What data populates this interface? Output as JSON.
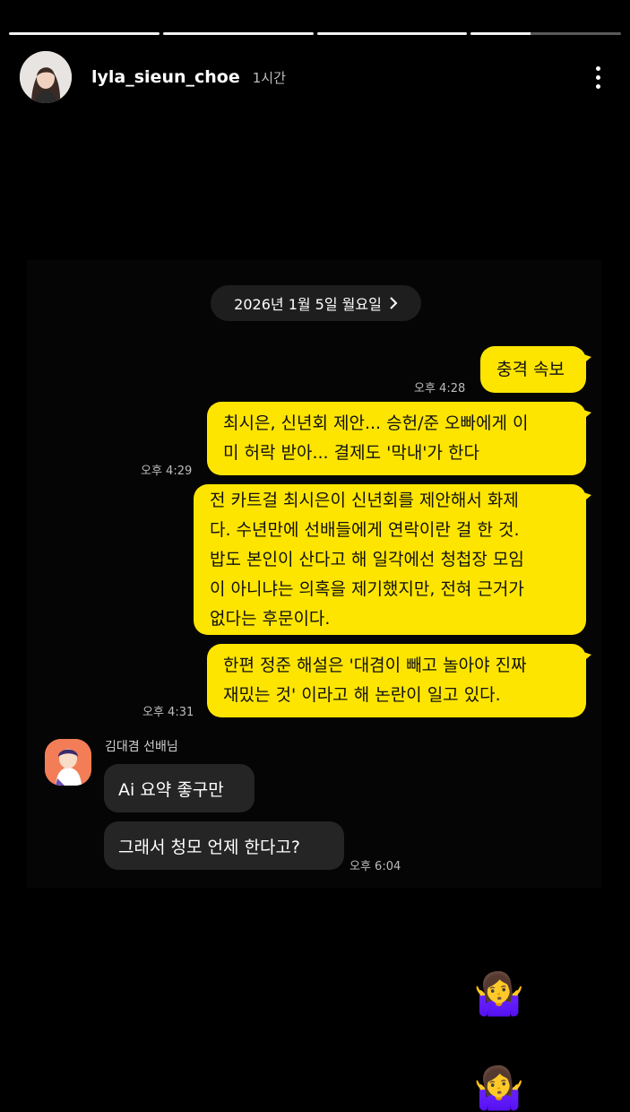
{
  "story": {
    "username": "lyla_sieun_choe",
    "time_ago": "1시간",
    "progress": [
      1,
      1,
      1,
      0.4
    ]
  },
  "chat": {
    "date_chip": "2026년 1월 5일 월요일",
    "date_chevron": "chevron-right-icon",
    "my_messages": [
      {
        "lines": [
          "충격 속보"
        ],
        "time": "오후 4:28"
      },
      {
        "lines": [
          "최시은, 신년회 제안... 승헌/준 오빠에게 이",
          "미 허락 받아... 결제도 '막내'가 한다"
        ],
        "time": "오후 4:29"
      },
      {
        "lines": [
          "전 카트걸 최시은이 신년회를 제안해서 화제",
          "다. 수년만에 선배들에게 연락이란 걸 한 것.",
          "밥도 본인이 산다고 해 일각에선 청첩장 모임",
          "이 아니냐는 의혹을 제기했지만, 전혀 근거가",
          "없다는 후문이다."
        ],
        "time": ""
      },
      {
        "lines": [
          "한편 정준 해설은 '대겸이 빼고 놀아야 진짜",
          "재밌는 것' 이라고 해 논란이 일고 있다."
        ],
        "time": "오후 4:31"
      }
    ],
    "sender_name": "김대겸 선배님",
    "their_messages": [
      {
        "text": "Ai 요약 좋구만",
        "time": ""
      },
      {
        "text": "그래서 청모 언제 한다고?",
        "time": "오후 6:04"
      }
    ]
  },
  "stickers": {
    "emoji_1": "🤷‍♀️",
    "emoji_2": "🤷‍♀️"
  },
  "colors": {
    "background": "#000000",
    "my_bubble": "#fee500",
    "their_bubble": "#252525",
    "date_chip": "#1e1e1e"
  }
}
